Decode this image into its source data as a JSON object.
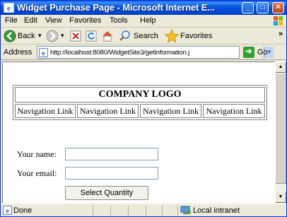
{
  "window": {
    "title": "Widget Purchase Page - Microsoft Internet E...",
    "min_label": "_",
    "max_label": "□",
    "close_label": "×"
  },
  "menu": [
    "File",
    "Edit",
    "View",
    "Favorites",
    "Tools",
    "Help"
  ],
  "toolbar": {
    "back_label": "Back",
    "search_label": "Search",
    "favorites_label": "Favorites",
    "more_label": "»"
  },
  "address": {
    "label": "Address",
    "url": "http://localhost:8080/WidgetSite3/getInformation.j",
    "go_label": "Go"
  },
  "page": {
    "logo": "COMPANY LOGO",
    "nav_links": [
      "Navigation Link",
      "Navigation Link",
      "Navigation Link",
      "Navigation Link"
    ],
    "name_label": "Your name:",
    "name_value": "",
    "email_label": "Your email:",
    "email_value": "",
    "submit_label": "Select Quantity"
  },
  "status": {
    "text": "Done",
    "zone": "Local intranet"
  },
  "colors": {
    "titlebar": "#0a58e0",
    "chrome": "#ece9d8"
  }
}
